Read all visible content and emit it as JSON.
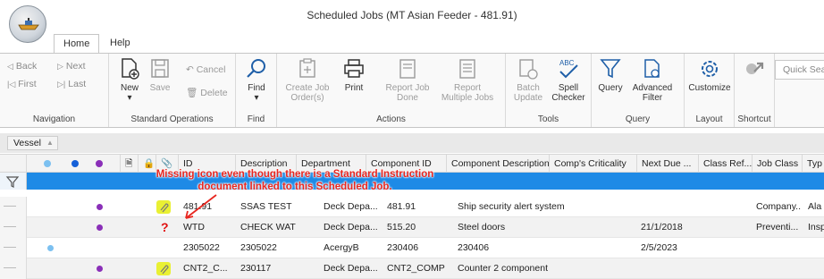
{
  "window": {
    "title": "Scheduled Jobs (MT Asian Feeder - 481.91)"
  },
  "tabs": [
    {
      "label": "Home"
    },
    {
      "label": "Help"
    }
  ],
  "ribbon": {
    "navigation": {
      "label": "Navigation",
      "back": "Back",
      "next": "Next",
      "first": "First",
      "last": "Last"
    },
    "standard": {
      "label": "Standard Operations",
      "new": "New",
      "save": "Save",
      "cancel": "Cancel",
      "delete": "Delete"
    },
    "find": {
      "label": "Find",
      "find": "Find"
    },
    "actions": {
      "label": "Actions",
      "create_job_1": "Create Job",
      "create_job_2": "Order(s)",
      "print": "Print",
      "report_done_1": "Report Job",
      "report_done_2": "Done",
      "report_multi_1": "Report",
      "report_multi_2": "Multiple Jobs"
    },
    "tools": {
      "label": "Tools",
      "batch_1": "Batch",
      "batch_2": "Update",
      "spell_1": "Spell",
      "spell_2": "Checker",
      "spell_badge": "ABC"
    },
    "query": {
      "label": "Query",
      "query": "Query",
      "adv_1": "Advanced",
      "adv_2": "Filter"
    },
    "layout": {
      "label": "Layout",
      "customize": "Customize"
    },
    "shortcut": {
      "label": "Shortcut"
    },
    "quick_search_placeholder": "Quick Sea"
  },
  "grid": {
    "group_chip": "Vessel",
    "columns": [
      "ID",
      "Description",
      "Department",
      "Component ID",
      "Component Description",
      "Comp's Criticality",
      "Next Due ...",
      "Class Ref...",
      "Job Class",
      "Typ"
    ],
    "rows": [
      {
        "id": "481.91",
        "description": "SSAS TEST",
        "department": "Deck Depa...",
        "component_id": "481.91",
        "component_desc": "Ship security alert system",
        "criticality": "",
        "next_due": "",
        "class_ref": "",
        "job_class": "Company...",
        "type": "Ala"
      },
      {
        "id": "WTD",
        "description": "CHECK WATER...",
        "department": "Deck Depa...",
        "component_id": "515.20",
        "component_desc": "Steel doors",
        "criticality": "",
        "next_due": "21/1/2018",
        "class_ref": "",
        "job_class": "Preventi...",
        "type": "Insp"
      },
      {
        "id": "2305022",
        "description": "2305022",
        "department": "AcergyB",
        "component_id": "230406",
        "component_desc": "230406",
        "criticality": "",
        "next_due": "2/5/2023",
        "class_ref": "",
        "job_class": "",
        "type": ""
      },
      {
        "id": "CNT2_C...",
        "description": "230117",
        "department": "Deck Depa...",
        "component_id": "CNT2_COMP",
        "component_desc": "Counter 2 component",
        "criticality": "",
        "next_due": "",
        "class_ref": "",
        "job_class": "",
        "type": ""
      }
    ],
    "missing_marker": "?"
  },
  "annotation": {
    "line1": "Missing icon even though there is a Standard Instruction",
    "line2": "document linked to this Scheduled Job."
  },
  "colors": {
    "filter_row": "#1e8ae6",
    "annotation": "#e8261f",
    "dot_purple": "#8a2fb8",
    "dot_light_blue": "#7cc0f0",
    "dot_blue": "#1560d8",
    "attachment_highlight": "#e9f033"
  }
}
